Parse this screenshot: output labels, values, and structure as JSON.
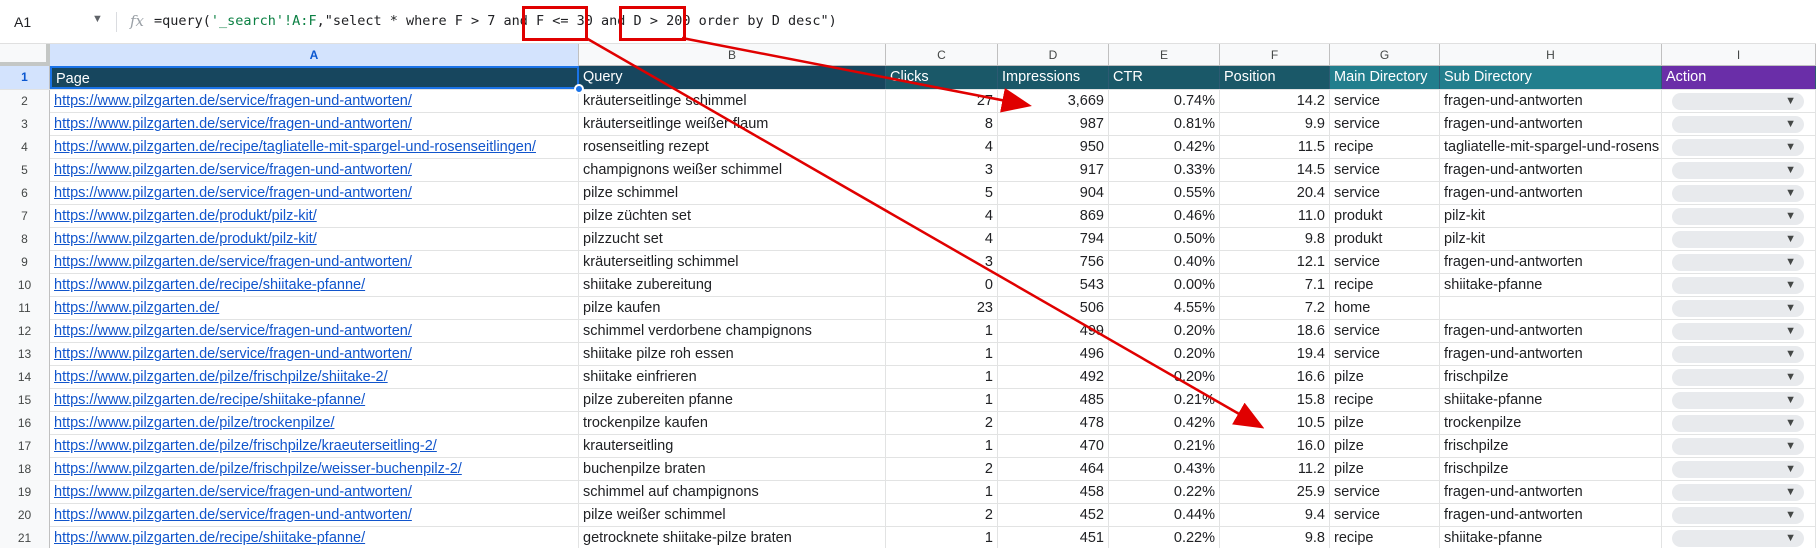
{
  "formula_bar": {
    "cell_ref": "A1",
    "formula_prefix": "=query(",
    "formula_range": "'_search'!A:F",
    "formula_query": ",\"select * where F > 7 and F <= 30 and D > 200 order by D desc\")"
  },
  "columns": [
    "A",
    "B",
    "C",
    "D",
    "E",
    "F",
    "G",
    "H",
    "I"
  ],
  "header_row": {
    "number": "1",
    "cells": [
      "Page",
      "Query",
      "Clicks",
      "Impressions",
      "CTR",
      "Position",
      "Main Directory",
      "Sub Directory",
      "Action"
    ]
  },
  "rows": [
    {
      "n": "2",
      "page": "https://www.pilzgarten.de/service/fragen-und-antworten/",
      "query": "kräuterseitlinge schimmel",
      "clicks": "27",
      "impr": "3,669",
      "ctr": "0.74%",
      "pos": "14.2",
      "main": "service",
      "sub": "fragen-und-antworten"
    },
    {
      "n": "3",
      "page": "https://www.pilzgarten.de/service/fragen-und-antworten/",
      "query": "kräuterseitlinge weißer flaum",
      "clicks": "8",
      "impr": "987",
      "ctr": "0.81%",
      "pos": "9.9",
      "main": "service",
      "sub": "fragen-und-antworten"
    },
    {
      "n": "4",
      "page": "https://www.pilzgarten.de/recipe/tagliatelle-mit-spargel-und-rosenseitlingen/",
      "query": "rosenseitling rezept",
      "clicks": "4",
      "impr": "950",
      "ctr": "0.42%",
      "pos": "11.5",
      "main": "recipe",
      "sub": "tagliatelle-mit-spargel-und-rosens"
    },
    {
      "n": "5",
      "page": "https://www.pilzgarten.de/service/fragen-und-antworten/",
      "query": "champignons weißer schimmel",
      "clicks": "3",
      "impr": "917",
      "ctr": "0.33%",
      "pos": "14.5",
      "main": "service",
      "sub": "fragen-und-antworten"
    },
    {
      "n": "6",
      "page": "https://www.pilzgarten.de/service/fragen-und-antworten/",
      "query": "pilze schimmel",
      "clicks": "5",
      "impr": "904",
      "ctr": "0.55%",
      "pos": "20.4",
      "main": "service",
      "sub": "fragen-und-antworten"
    },
    {
      "n": "7",
      "page": "https://www.pilzgarten.de/produkt/pilz-kit/",
      "query": "pilze züchten set",
      "clicks": "4",
      "impr": "869",
      "ctr": "0.46%",
      "pos": "11.0",
      "main": "produkt",
      "sub": "pilz-kit"
    },
    {
      "n": "8",
      "page": "https://www.pilzgarten.de/produkt/pilz-kit/",
      "query": "pilzzucht set",
      "clicks": "4",
      "impr": "794",
      "ctr": "0.50%",
      "pos": "9.8",
      "main": "produkt",
      "sub": "pilz-kit"
    },
    {
      "n": "9",
      "page": "https://www.pilzgarten.de/service/fragen-und-antworten/",
      "query": "kräuterseitling schimmel",
      "clicks": "3",
      "impr": "756",
      "ctr": "0.40%",
      "pos": "12.1",
      "main": "service",
      "sub": "fragen-und-antworten"
    },
    {
      "n": "10",
      "page": "https://www.pilzgarten.de/recipe/shiitake-pfanne/",
      "query": "shiitake zubereitung",
      "clicks": "0",
      "impr": "543",
      "ctr": "0.00%",
      "pos": "7.1",
      "main": "recipe",
      "sub": "shiitake-pfanne"
    },
    {
      "n": "11",
      "page": "https://www.pilzgarten.de/",
      "query": "pilze kaufen",
      "clicks": "23",
      "impr": "506",
      "ctr": "4.55%",
      "pos": "7.2",
      "main": "home",
      "sub": ""
    },
    {
      "n": "12",
      "page": "https://www.pilzgarten.de/service/fragen-und-antworten/",
      "query": "schimmel verdorbene champignons",
      "clicks": "1",
      "impr": "499",
      "ctr": "0.20%",
      "pos": "18.6",
      "main": "service",
      "sub": "fragen-und-antworten"
    },
    {
      "n": "13",
      "page": "https://www.pilzgarten.de/service/fragen-und-antworten/",
      "query": "shiitake pilze roh essen",
      "clicks": "1",
      "impr": "496",
      "ctr": "0.20%",
      "pos": "19.4",
      "main": "service",
      "sub": "fragen-und-antworten"
    },
    {
      "n": "14",
      "page": "https://www.pilzgarten.de/pilze/frischpilze/shiitake-2/",
      "query": "shiitake einfrieren",
      "clicks": "1",
      "impr": "492",
      "ctr": "0.20%",
      "pos": "16.6",
      "main": "pilze",
      "sub": "frischpilze"
    },
    {
      "n": "15",
      "page": "https://www.pilzgarten.de/recipe/shiitake-pfanne/",
      "query": "pilze zubereiten pfanne",
      "clicks": "1",
      "impr": "485",
      "ctr": "0.21%",
      "pos": "15.8",
      "main": "recipe",
      "sub": "shiitake-pfanne"
    },
    {
      "n": "16",
      "page": "https://www.pilzgarten.de/pilze/trockenpilze/",
      "query": "trockenpilze kaufen",
      "clicks": "2",
      "impr": "478",
      "ctr": "0.42%",
      "pos": "10.5",
      "main": "pilze",
      "sub": "trockenpilze"
    },
    {
      "n": "17",
      "page": "https://www.pilzgarten.de/pilze/frischpilze/kraeuterseitling-2/",
      "query": "krauterseitling",
      "clicks": "1",
      "impr": "470",
      "ctr": "0.21%",
      "pos": "16.0",
      "main": "pilze",
      "sub": "frischpilze"
    },
    {
      "n": "18",
      "page": "https://www.pilzgarten.de/pilze/frischpilze/weisser-buchenpilz-2/",
      "query": "buchenpilze braten",
      "clicks": "2",
      "impr": "464",
      "ctr": "0.43%",
      "pos": "11.2",
      "main": "pilze",
      "sub": "frischpilze"
    },
    {
      "n": "19",
      "page": "https://www.pilzgarten.de/service/fragen-und-antworten/",
      "query": "schimmel auf champignons",
      "clicks": "1",
      "impr": "458",
      "ctr": "0.22%",
      "pos": "25.9",
      "main": "service",
      "sub": "fragen-und-antworten"
    },
    {
      "n": "20",
      "page": "https://www.pilzgarten.de/service/fragen-und-antworten/",
      "query": "pilze weißer schimmel",
      "clicks": "2",
      "impr": "452",
      "ctr": "0.44%",
      "pos": "9.4",
      "main": "service",
      "sub": "fragen-und-antworten"
    },
    {
      "n": "21",
      "page": "https://www.pilzgarten.de/recipe/shiitake-pfanne/",
      "query": "getrocknete shiitake-pilze braten",
      "clicks": "1",
      "impr": "451",
      "ctr": "0.22%",
      "pos": "9.8",
      "main": "recipe",
      "sub": "shiitake-pfanne"
    }
  ],
  "colors": {
    "header_dark": "#17465e",
    "header_teal": "#227e8d",
    "header_action": "#6a2ea8",
    "link": "#1155cc",
    "annotation": "#e00000",
    "selection": "#1a73e8"
  },
  "icons": {
    "fx": "function-icon",
    "dropdown": "chevron-down-icon"
  }
}
